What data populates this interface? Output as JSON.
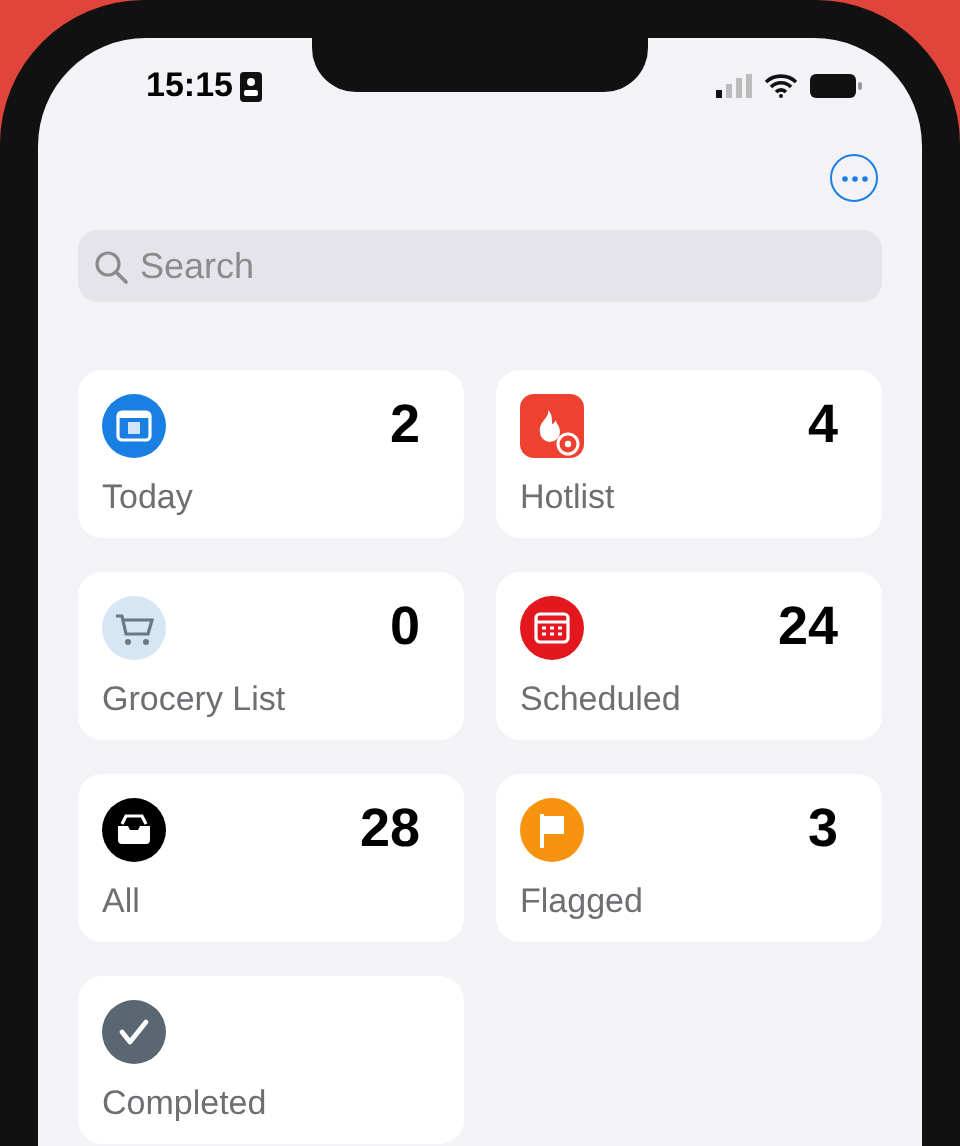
{
  "status_bar": {
    "time": "15:15"
  },
  "search": {
    "placeholder": "Search"
  },
  "lists": [
    {
      "kind": "today",
      "label": "Today",
      "count": "2",
      "color": "#1a7fe3"
    },
    {
      "kind": "hotlist",
      "label": "Hotlist",
      "count": "4",
      "color": "#ee4130"
    },
    {
      "kind": "grocery",
      "label": "Grocery List",
      "count": "0",
      "color": "#d6e6f4"
    },
    {
      "kind": "scheduled",
      "label": "Scheduled",
      "count": "24",
      "color": "#e3181f"
    },
    {
      "kind": "all",
      "label": "All",
      "count": "28",
      "color": "#000000"
    },
    {
      "kind": "flagged",
      "label": "Flagged",
      "count": "3",
      "color": "#f7930f"
    },
    {
      "kind": "completed",
      "label": "Completed",
      "color": "#5a6670"
    }
  ]
}
